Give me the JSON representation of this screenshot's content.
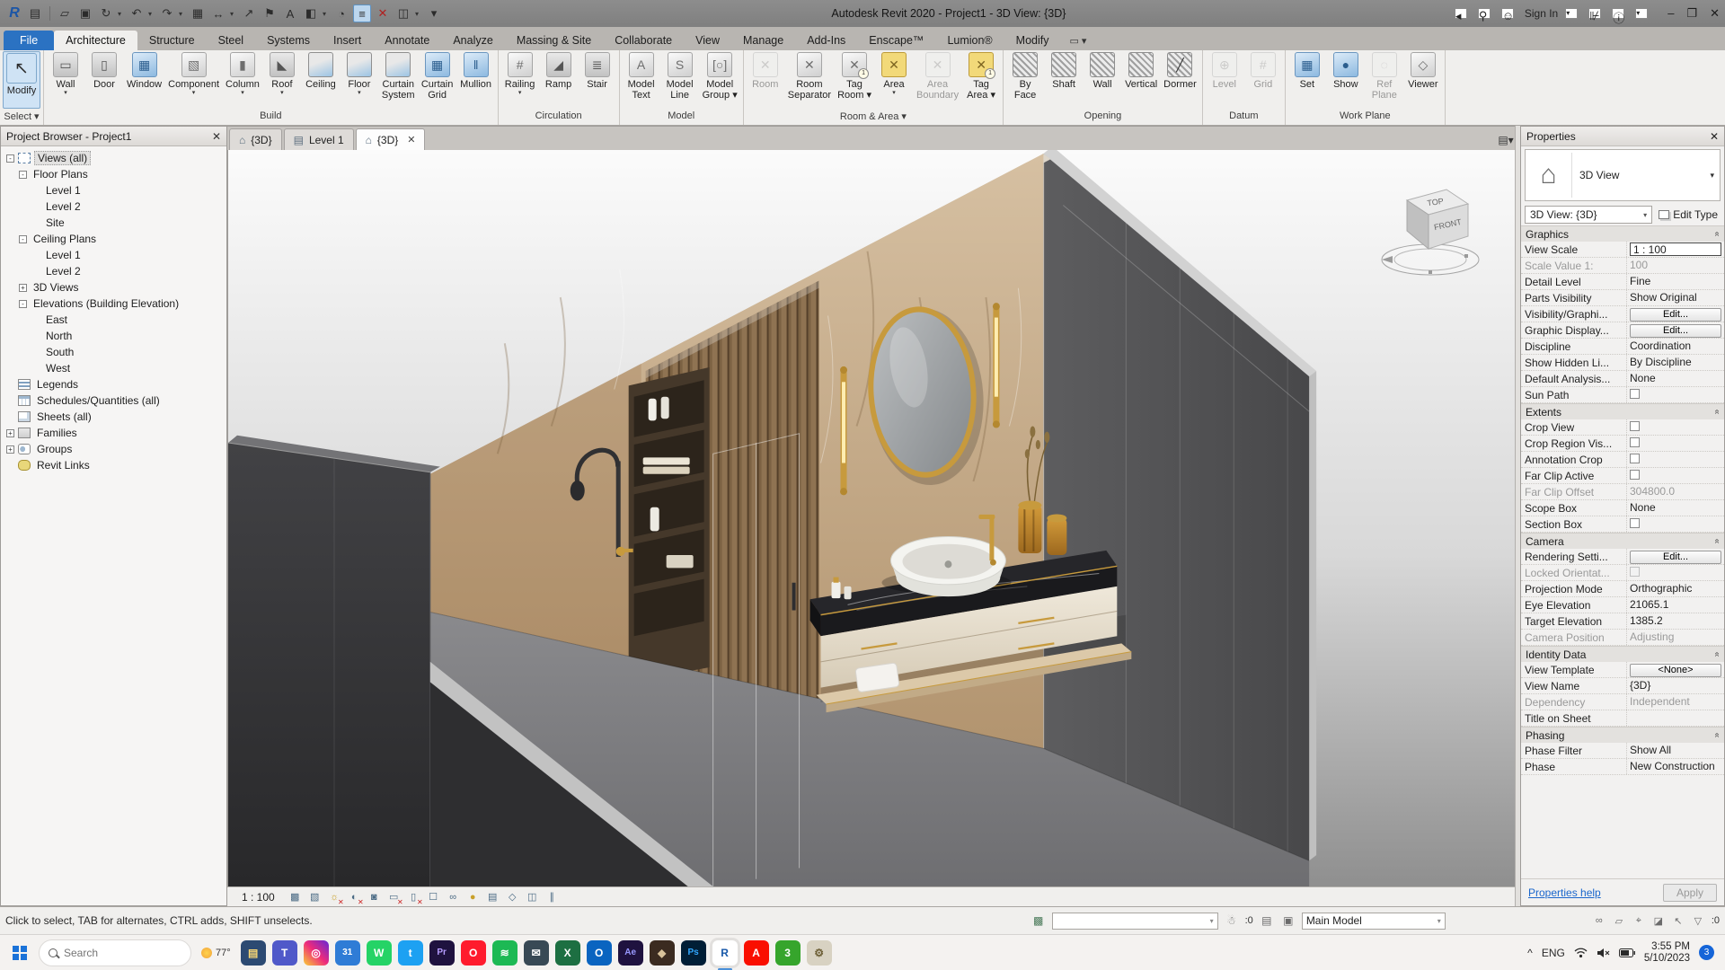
{
  "colors": {
    "accent_blue": "#2b72c2",
    "ribbon_bg": "#f0efed",
    "titlebar": "#868686",
    "gold": "#c79a3d",
    "marble": "#c8b193",
    "wall_dark": "#3a3a3c",
    "wall_right": "#525254",
    "selection_blue": "#cfe3f5"
  },
  "title_bar": {
    "title": "Autodesk Revit 2020 - Project1 - 3D View: {3D}",
    "sign_in": "Sign In",
    "qat": [
      {
        "id": "revit-logo",
        "g": "R"
      },
      {
        "id": "app-menu",
        "g": "▤",
        "sep": true
      },
      {
        "id": "open",
        "g": "▱"
      },
      {
        "id": "save",
        "g": "▣"
      },
      {
        "id": "sync-with-central",
        "g": "↻",
        "drop": true
      },
      {
        "id": "undo",
        "g": "↶",
        "drop": true
      },
      {
        "id": "redo",
        "g": "↷",
        "drop": true
      },
      {
        "id": "print",
        "g": "▦"
      },
      {
        "id": "measure",
        "g": "↔",
        "drop": true
      },
      {
        "id": "aligned-dimension",
        "g": "↗"
      },
      {
        "id": "tag-by-category",
        "g": "⚑"
      },
      {
        "id": "text",
        "g": "A"
      },
      {
        "id": "default-3d-view",
        "g": "◧",
        "drop": true
      },
      {
        "id": "section",
        "g": "◔"
      },
      {
        "id": "thin-lines",
        "g": "≡"
      },
      {
        "id": "close-hidden-windows",
        "g": "✕"
      },
      {
        "id": "switch-windows",
        "g": "◫",
        "drop": true
      },
      {
        "id": "customize-qat",
        "g": "▾"
      }
    ]
  },
  "ribbon": {
    "tabs": [
      {
        "label": "File",
        "style": "file"
      },
      {
        "label": "Architecture",
        "active": true
      },
      {
        "label": "Structure"
      },
      {
        "label": "Steel"
      },
      {
        "label": "Systems"
      },
      {
        "label": "Insert"
      },
      {
        "label": "Annotate"
      },
      {
        "label": "Analyze"
      },
      {
        "label": "Massing & Site"
      },
      {
        "label": "Collaborate"
      },
      {
        "label": "View"
      },
      {
        "label": "Manage"
      },
      {
        "label": "Add-Ins"
      },
      {
        "label": "Enscape™"
      },
      {
        "label": "Lumion®"
      },
      {
        "label": "Modify"
      }
    ],
    "panels": [
      {
        "label": "Select",
        "caret": true,
        "buttons": [
          {
            "label": "Modify",
            "icon": "modify",
            "big": true,
            "selected": true
          }
        ]
      },
      {
        "label": "Build",
        "buttons": [
          {
            "label": "Wall",
            "icon": "wall",
            "arrow": true
          },
          {
            "label": "Door",
            "icon": "door"
          },
          {
            "label": "Window",
            "icon": "window"
          },
          {
            "label": "Component",
            "icon": "component",
            "arrow": true
          },
          {
            "label": "Column",
            "icon": "column",
            "arrow": true
          },
          {
            "label": "Roof",
            "icon": "roof",
            "arrow": true
          },
          {
            "label": "Ceiling",
            "icon": "ceiling"
          },
          {
            "label": "Floor",
            "icon": "floor",
            "arrow": true
          },
          {
            "label": "Curtain\nSystem",
            "icon": "curtain-system"
          },
          {
            "label": "Curtain\nGrid",
            "icon": "curtain-grid"
          },
          {
            "label": "Mullion",
            "icon": "mullion"
          }
        ]
      },
      {
        "label": "Circulation",
        "buttons": [
          {
            "label": "Railing",
            "icon": "railing",
            "arrow": true
          },
          {
            "label": "Ramp",
            "icon": "ramp"
          },
          {
            "label": "Stair",
            "icon": "stair"
          }
        ]
      },
      {
        "label": "Model",
        "buttons": [
          {
            "label": "Model\nText",
            "icon": "model-text"
          },
          {
            "label": "Model\nLine",
            "icon": "model-line"
          },
          {
            "label": "Model\nGroup",
            "icon": "model-group",
            "arrow": true
          }
        ]
      },
      {
        "label": "Room & Area",
        "caret": true,
        "buttons": [
          {
            "label": "Room",
            "icon": "room",
            "disabled": true
          },
          {
            "label": "Room\nSeparator",
            "icon": "room-separator"
          },
          {
            "label": "Tag\nRoom",
            "icon": "tag-room",
            "arrow": true
          },
          {
            "label": "Area",
            "icon": "area",
            "arrow": true
          },
          {
            "label": "Area\nBoundary",
            "icon": "area-boundary",
            "disabled": true
          },
          {
            "label": "Tag\nArea",
            "icon": "tag-area",
            "arrow": true
          }
        ]
      },
      {
        "label": "Opening",
        "buttons": [
          {
            "label": "By\nFace",
            "icon": "by-face"
          },
          {
            "label": "Shaft",
            "icon": "shaft"
          },
          {
            "label": "Wall",
            "icon": "wall-opening"
          },
          {
            "label": "Vertical",
            "icon": "vertical-opening"
          },
          {
            "label": "Dormer",
            "icon": "dormer"
          }
        ]
      },
      {
        "label": "Datum",
        "buttons": [
          {
            "label": "Level",
            "icon": "level",
            "disabled": true
          },
          {
            "label": "Grid",
            "icon": "grid",
            "disabled": true
          }
        ]
      },
      {
        "label": "Work Plane",
        "buttons": [
          {
            "label": "Set",
            "icon": "set"
          },
          {
            "label": "Show",
            "icon": "show"
          },
          {
            "label": "Ref\nPlane",
            "icon": "ref-plane",
            "disabled": true
          },
          {
            "label": "Viewer",
            "icon": "viewer"
          }
        ]
      }
    ]
  },
  "doc_tabs": [
    {
      "label": "{3D}",
      "icon": "house"
    },
    {
      "label": "Level 1",
      "icon": "plan"
    },
    {
      "label": "{3D}",
      "icon": "house",
      "active": true,
      "close": true
    }
  ],
  "project_browser": {
    "title": "Project Browser - Project1",
    "tree": [
      {
        "label": "Views (all)",
        "depth": 0,
        "exp": "minus",
        "icon": "views",
        "sel": true
      },
      {
        "label": "Floor Plans",
        "depth": 1,
        "exp": "minus"
      },
      {
        "label": "Level 1",
        "depth": 2
      },
      {
        "label": "Level 2",
        "depth": 2
      },
      {
        "label": "Site",
        "depth": 2
      },
      {
        "label": "Ceiling Plans",
        "depth": 1,
        "exp": "minus"
      },
      {
        "label": "Level 1",
        "depth": 2
      },
      {
        "label": "Level 2",
        "depth": 2
      },
      {
        "label": "3D Views",
        "depth": 1,
        "exp": "plus"
      },
      {
        "label": "Elevations (Building Elevation)",
        "depth": 1,
        "exp": "minus"
      },
      {
        "label": "East",
        "depth": 2
      },
      {
        "label": "North",
        "depth": 2
      },
      {
        "label": "South",
        "depth": 2
      },
      {
        "label": "West",
        "depth": 2
      },
      {
        "label": "Legends",
        "depth": 0,
        "icon": "legends"
      },
      {
        "label": "Schedules/Quantities (all)",
        "depth": 0,
        "icon": "schedules"
      },
      {
        "label": "Sheets (all)",
        "depth": 0,
        "icon": "sheets"
      },
      {
        "label": "Families",
        "depth": 0,
        "exp": "plus",
        "icon": "families"
      },
      {
        "label": "Groups",
        "depth": 0,
        "exp": "plus",
        "icon": "groups"
      },
      {
        "label": "Revit Links",
        "depth": 0,
        "icon": "links"
      }
    ]
  },
  "properties": {
    "header": "Properties",
    "type_label": "3D View",
    "type_selector": "3D View: {3D}",
    "edit_type": "Edit Type",
    "sections": [
      {
        "title": "Graphics",
        "rows": [
          {
            "label": "View Scale",
            "value": "1 : 100",
            "kind": "input"
          },
          {
            "label": "Scale Value   1:",
            "value": "100",
            "kind": "gray",
            "labgray": true
          },
          {
            "label": "Detail Level",
            "value": "Fine",
            "kind": "text"
          },
          {
            "label": "Parts Visibility",
            "value": "Show Original",
            "kind": "text"
          },
          {
            "label": "Visibility/Graphi...",
            "value": "Edit...",
            "kind": "btn"
          },
          {
            "label": "Graphic Display...",
            "value": "Edit...",
            "kind": "btn"
          },
          {
            "label": "Discipline",
            "value": "Coordination",
            "kind": "text"
          },
          {
            "label": "Show Hidden Li...",
            "value": "By Discipline",
            "kind": "text"
          },
          {
            "label": "Default Analysis...",
            "value": "None",
            "kind": "text"
          },
          {
            "label": "Sun Path",
            "value": "",
            "kind": "check"
          }
        ]
      },
      {
        "title": "Extents",
        "rows": [
          {
            "label": "Crop View",
            "value": "",
            "kind": "check"
          },
          {
            "label": "Crop Region Vis...",
            "value": "",
            "kind": "check"
          },
          {
            "label": "Annotation Crop",
            "value": "",
            "kind": "check"
          },
          {
            "label": "Far Clip Active",
            "value": "",
            "kind": "check"
          },
          {
            "label": "Far Clip Offset",
            "value": "304800.0",
            "kind": "gray",
            "labgray": true
          },
          {
            "label": "Scope Box",
            "value": "None",
            "kind": "text"
          },
          {
            "label": "Section Box",
            "value": "",
            "kind": "check"
          }
        ]
      },
      {
        "title": "Camera",
        "rows": [
          {
            "label": "Rendering Setti...",
            "value": "Edit...",
            "kind": "btn"
          },
          {
            "label": "Locked Orientat...",
            "value": "",
            "kind": "checkgray",
            "labgray": true
          },
          {
            "label": "Projection Mode",
            "value": "Orthographic",
            "kind": "text"
          },
          {
            "label": "Eye Elevation",
            "value": "21065.1",
            "kind": "text"
          },
          {
            "label": "Target Elevation",
            "value": "1385.2",
            "kind": "text"
          },
          {
            "label": "Camera Position",
            "value": "Adjusting",
            "kind": "gray",
            "labgray": true
          }
        ]
      },
      {
        "title": "Identity Data",
        "rows": [
          {
            "label": "View Template",
            "value": "<None>",
            "kind": "btn"
          },
          {
            "label": "View Name",
            "value": "{3D}",
            "kind": "text"
          },
          {
            "label": "Dependency",
            "value": "Independent",
            "kind": "gray",
            "labgray": true
          },
          {
            "label": "Title on Sheet",
            "value": "",
            "kind": "empty"
          }
        ]
      },
      {
        "title": "Phasing",
        "rows": [
          {
            "label": "Phase Filter",
            "value": "Show All",
            "kind": "text"
          },
          {
            "label": "Phase",
            "value": "New Construction",
            "kind": "text"
          }
        ]
      }
    ],
    "help": "Properties help",
    "apply": "Apply"
  },
  "view_control": {
    "scale": "1 : 100",
    "icons": [
      {
        "id": "visual-style",
        "g": "▩"
      },
      {
        "id": "detail-level",
        "g": "▧"
      },
      {
        "id": "sun-path",
        "g": "☼",
        "redx": true,
        "yellow": true
      },
      {
        "id": "shadows",
        "g": "◐",
        "redx": true
      },
      {
        "id": "render-dialog",
        "g": "◙"
      },
      {
        "id": "crop-view",
        "g": "▭",
        "redx": true
      },
      {
        "id": "show-crop-region",
        "g": "▯",
        "redx": true
      },
      {
        "id": "unlocked-view",
        "g": "☐"
      },
      {
        "id": "temporary-hide-isolate",
        "g": "∞"
      },
      {
        "id": "reveal-hidden",
        "g": "●",
        "yellow": true
      },
      {
        "id": "temporary-view-properties",
        "g": "▤"
      },
      {
        "id": "analytical-model",
        "g": "◇"
      },
      {
        "id": "displacement-sets",
        "g": "◫"
      },
      {
        "id": "reveal-constraints",
        "g": "∥"
      }
    ]
  },
  "status_bar": {
    "hint": "Click to select, TAB for alternates, CTRL adds, SHIFT unselects.",
    "active_workset": "",
    "editing_requests": ":0",
    "design_option": "Main Model",
    "selection_count": ":0",
    "right_icons": [
      {
        "id": "select-links",
        "g": "∞"
      },
      {
        "id": "select-underlay",
        "g": "▱"
      },
      {
        "id": "select-pinned",
        "g": "⌖"
      },
      {
        "id": "select-by-face",
        "g": "◪"
      },
      {
        "id": "drag-on-selection",
        "g": "↖"
      },
      {
        "id": "selection-filter",
        "g": "▽"
      }
    ]
  },
  "viewcube": {
    "top_label": "TOP",
    "front_label": "FRONT"
  },
  "taskbar": {
    "search_placeholder": "Search",
    "weather_temp": "77°",
    "apps": [
      {
        "id": "file-explorer",
        "bg": "#2c4a72",
        "g": "▤",
        "fg": "#f8d775"
      },
      {
        "id": "teams",
        "bg": "#5059c9",
        "g": "T"
      },
      {
        "id": "instagram",
        "bg": "linear-gradient(45deg,#f9ce34,#ee2a7b,#6228d7)",
        "g": "◎"
      },
      {
        "id": "calendar",
        "bg": "#2f7cd6",
        "g": "31",
        "small": true
      },
      {
        "id": "whatsapp",
        "bg": "#25d366",
        "g": "W"
      },
      {
        "id": "twitter",
        "bg": "#1da1f2",
        "g": "t"
      },
      {
        "id": "premiere",
        "bg": "#1f123f",
        "g": "Pr",
        "fg": "#b69cff",
        "small": true
      },
      {
        "id": "opera",
        "bg": "#ff1b2d",
        "g": "O"
      },
      {
        "id": "spotify",
        "bg": "#1db954",
        "g": "≋"
      },
      {
        "id": "mail",
        "bg": "#384955",
        "g": "✉"
      },
      {
        "id": "excel",
        "bg": "#1d6f42",
        "g": "X"
      },
      {
        "id": "outlook",
        "bg": "#0a64c0",
        "g": "O"
      },
      {
        "id": "after-effects",
        "bg": "#1f123f",
        "g": "Ae",
        "fg": "#9999ff",
        "small": true
      },
      {
        "id": "render-app",
        "bg": "#3b2b20",
        "g": "◆",
        "fg": "#d8c29a"
      },
      {
        "id": "photoshop",
        "bg": "#001e36",
        "g": "Ps",
        "fg": "#31a8ff",
        "small": true
      },
      {
        "id": "revit",
        "bg": "#ffffff",
        "g": "R",
        "fg": "#1858a8",
        "active": true
      },
      {
        "id": "acrobat",
        "bg": "#fa0f00",
        "g": "A"
      },
      {
        "id": "3ds-max",
        "bg": "#36a52c",
        "g": "3"
      },
      {
        "id": "settings",
        "bg": "#d8d2c2",
        "g": "⚙",
        "fg": "#6b5d33"
      }
    ],
    "tray": {
      "language": "ENG",
      "time": "3:55 PM",
      "date": "5/10/2023",
      "badge": "3"
    }
  }
}
